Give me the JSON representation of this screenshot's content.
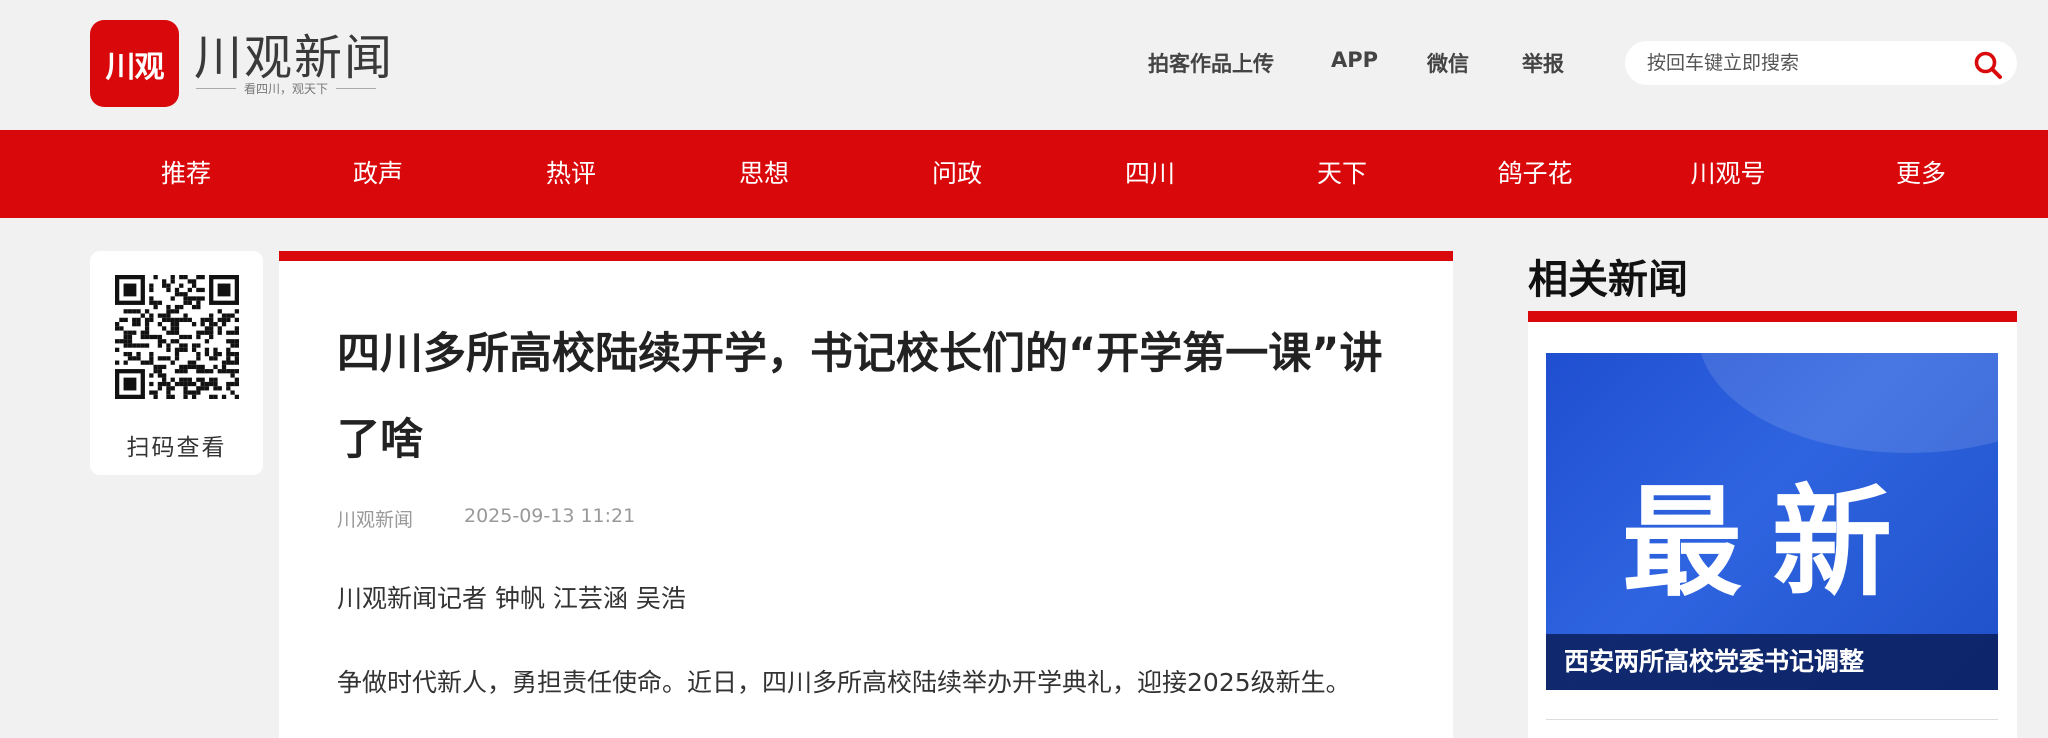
{
  "header": {
    "logo_mark": "川观",
    "logo_name": "川观新闻",
    "logo_slogan": "看四川，观天下",
    "links": [
      "拍客作品上传",
      "APP",
      "微信",
      "举报"
    ],
    "search_placeholder": "按回车键立即搜索"
  },
  "nav": {
    "items": [
      "推荐",
      "政声",
      "热评",
      "思想",
      "问政",
      "四川",
      "天下",
      "鸽子花",
      "川观号",
      "更多"
    ]
  },
  "qr": {
    "label": "扫码查看"
  },
  "article": {
    "title": "四川多所高校陆续开学，书记校长们的“开学第一课”讲了啥",
    "source": "川观新闻",
    "time": "2025-09-13 11:21",
    "byline": "川观新闻记者 钟帆 江芸涵 吴浩",
    "paragraph": "争做时代新人，勇担责任使命。近日，四川多所高校陆续举办开学典礼，迎接2025级新生。"
  },
  "related": {
    "heading": "相关新闻",
    "items": [
      {
        "image_text": "最新",
        "caption": "西安两所高校党委书记调整"
      }
    ]
  },
  "colors": {
    "brand_red": "#d9090b",
    "image_blue": "#2f64e0"
  }
}
